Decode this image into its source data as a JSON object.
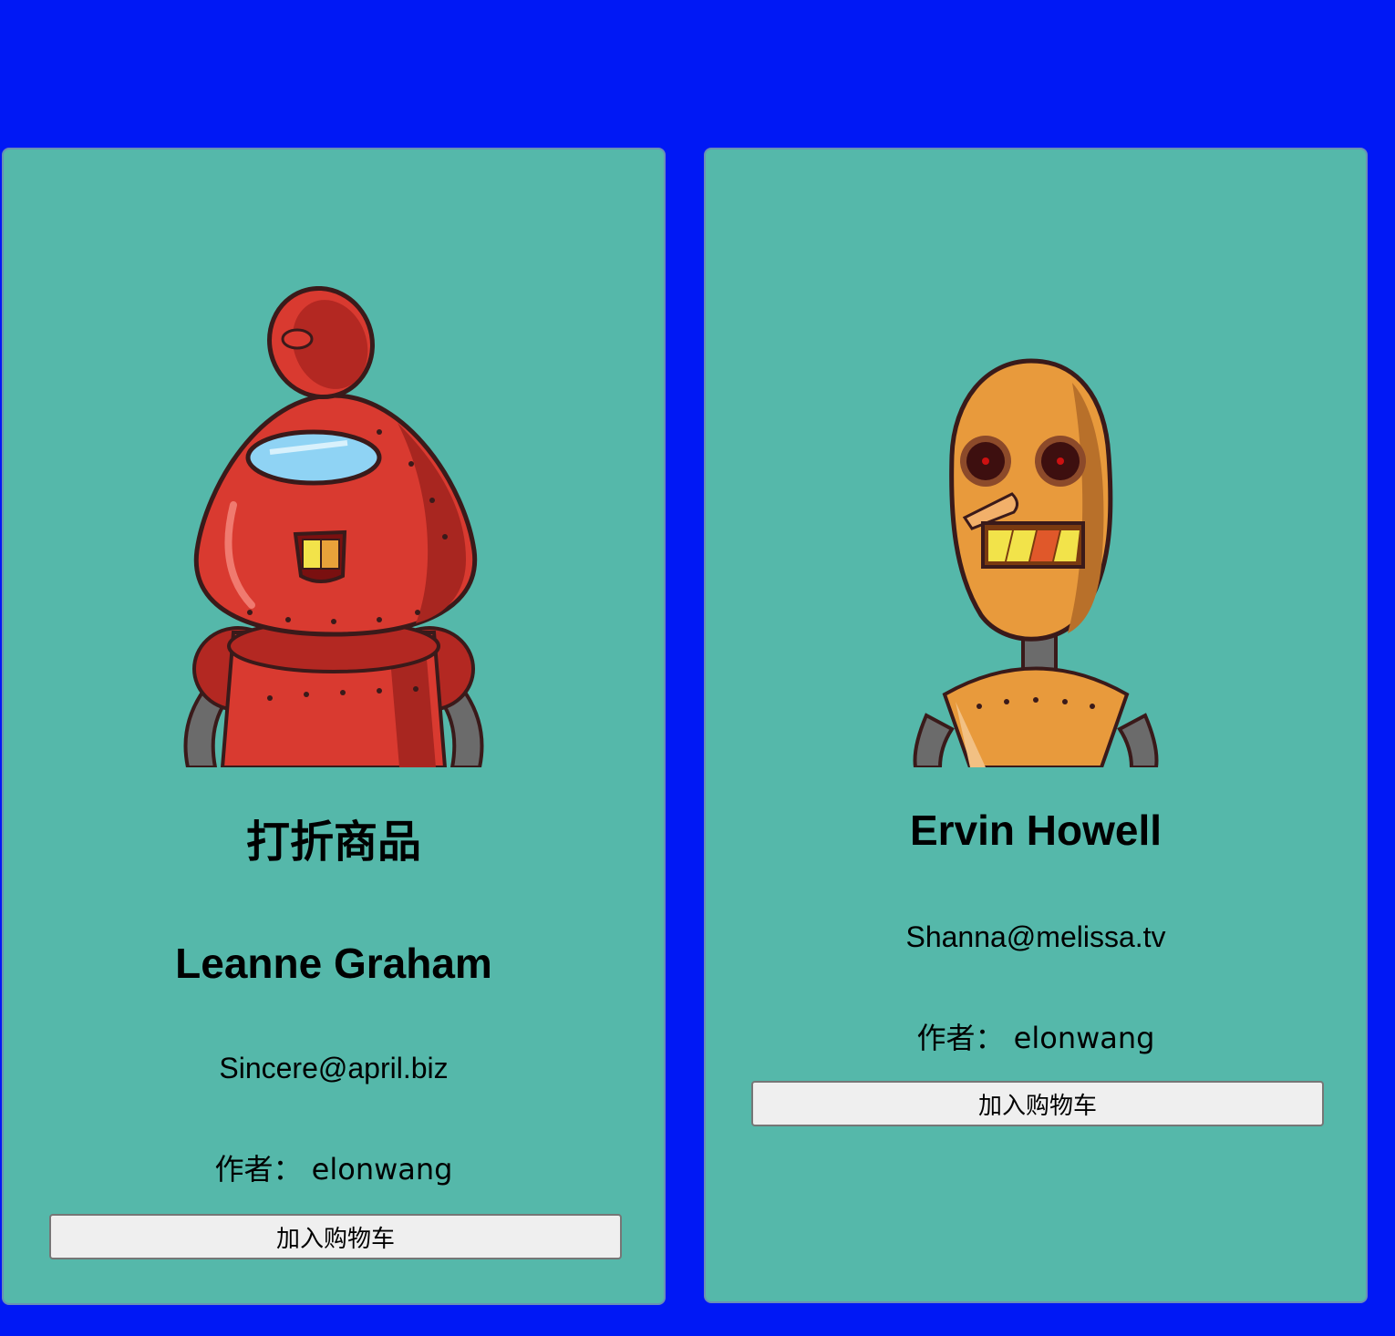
{
  "products": [
    {
      "discount_label": "打折商品",
      "name": "Leanne Graham",
      "email": "Sincere@april.biz",
      "author": "作者： elonwang",
      "button_label": "加入购物车",
      "image_icon": "red-robot-icon"
    },
    {
      "name": "Ervin Howell",
      "email": "Shanna@melissa.tv",
      "author": "作者： elonwang",
      "button_label": "加入购物车",
      "image_icon": "orange-robot-icon"
    }
  ],
  "colors": {
    "page_background": "#0018f5",
    "card_background": "#55b8aa",
    "button_background": "#efefef"
  }
}
